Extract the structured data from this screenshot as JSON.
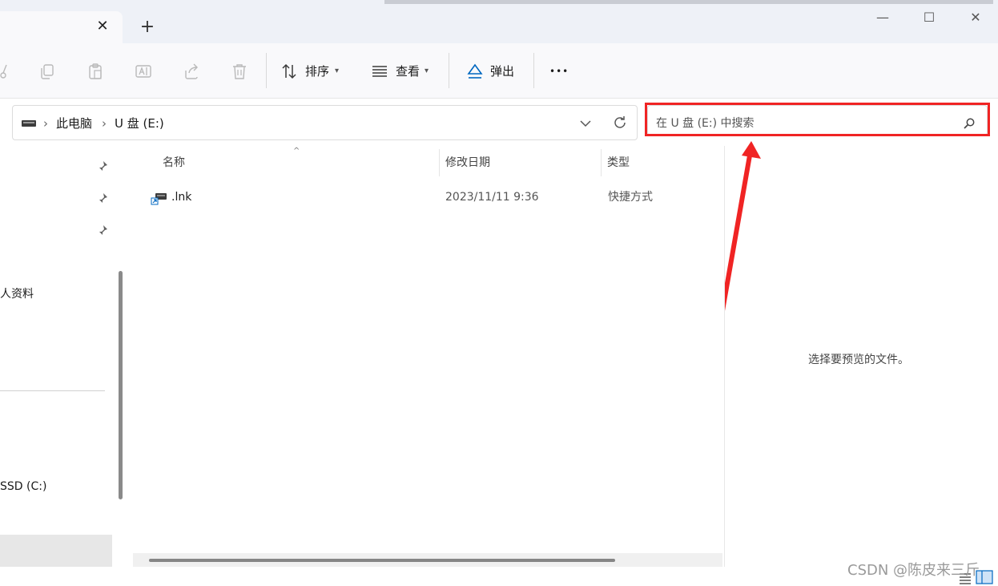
{
  "titlebar": {
    "tab_close": "✕",
    "new_tab": "+",
    "minimize": "—",
    "maximize": "☐",
    "close": "✕"
  },
  "toolbar": {
    "sort_label": "排序",
    "view_label": "查看",
    "eject_label": "弹出",
    "more_label": "•••"
  },
  "address": {
    "crumbs": [
      "此电脑",
      "U 盘 (E:)"
    ],
    "search_placeholder": "在 U 盘 (E:) 中搜索"
  },
  "nav": {
    "item_profile": "人资料",
    "item_drive": "SSD (C:)"
  },
  "filelist": {
    "columns": [
      "名称",
      "修改日期",
      "类型"
    ],
    "rows": [
      {
        "name": ".lnk",
        "modified": "2023/11/11 9:36",
        "type": "快捷方式"
      }
    ]
  },
  "preview": {
    "message": "选择要预览的文件。"
  },
  "watermark": "CSDN @陈皮来三斤",
  "colors": {
    "highlight_red": "#f02424",
    "accent_blue": "#0067c0"
  }
}
